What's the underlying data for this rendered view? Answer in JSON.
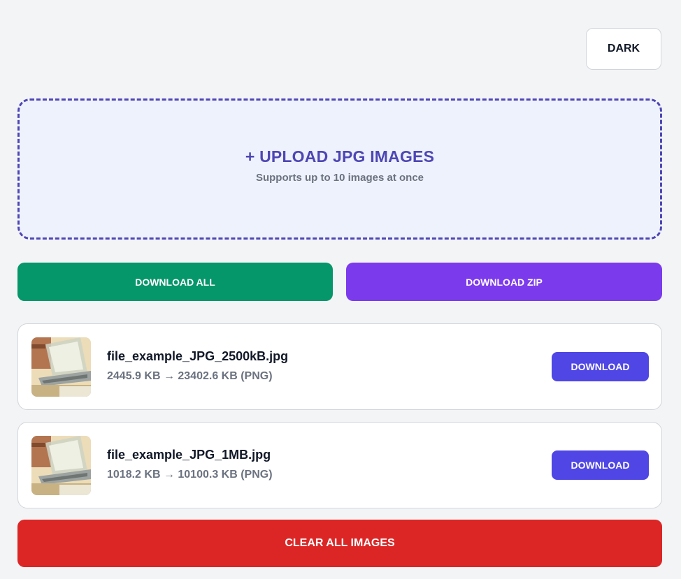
{
  "header": {
    "theme_toggle_label": "DARK"
  },
  "upload": {
    "title": "+ UPLOAD JPG IMAGES",
    "subtitle": "Supports up to 10 images at once"
  },
  "actions": {
    "download_all_label": "DOWNLOAD ALL",
    "download_zip_label": "DOWNLOAD ZIP",
    "clear_all_label": "CLEAR ALL IMAGES"
  },
  "files": [
    {
      "name": "file_example_JPG_2500kB.jpg",
      "size_info": "2445.9 KB → 23402.6 KB (PNG)",
      "download_label": "DOWNLOAD"
    },
    {
      "name": "file_example_JPG_1MB.jpg",
      "size_info": "1018.2 KB → 10100.3 KB (PNG)",
      "download_label": "DOWNLOAD"
    }
  ],
  "colors": {
    "background": "#f3f4f6",
    "accent_indigo": "#4f46b5",
    "download_all_green": "#059669",
    "download_zip_purple": "#7c3aed",
    "file_download_blue": "#4f46e5",
    "clear_red": "#dc2626"
  }
}
